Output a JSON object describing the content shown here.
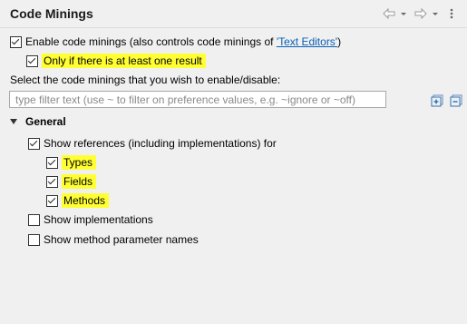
{
  "header": {
    "title": "Code Minings",
    "back_icon": "arrow-left-icon",
    "forward_icon": "arrow-right-icon",
    "menu_icon": "chevron-down-icon"
  },
  "options": {
    "enable": {
      "prefix": "Enable code minings (also controls code minings of ",
      "link": "'Text Editors'",
      "suffix": ")",
      "checked": true
    },
    "only_if_result": {
      "label": "Only if there is at least one result",
      "checked": true
    }
  },
  "filter": {
    "instruction": "Select the code minings that you wish to enable/disable:",
    "placeholder": "type filter text (use ~ to filter on preference values, e.g. ~ignore or ~off)",
    "value": ""
  },
  "toolbar": {
    "expand_all_icon": "expand-all-icon",
    "collapse_all_icon": "collapse-all-icon"
  },
  "tree": {
    "group_label": "General",
    "items": [
      {
        "label": "Show references (including implementations) for",
        "checked": true
      },
      {
        "label": "Types",
        "checked": true
      },
      {
        "label": "Fields",
        "checked": true
      },
      {
        "label": "Methods",
        "checked": true
      },
      {
        "label": "Show implementations",
        "checked": false
      },
      {
        "label": "Show method parameter names",
        "checked": false
      }
    ]
  },
  "colors": {
    "highlight": "#ffff33",
    "link": "#0b5fb6",
    "background": "#f0f0f0"
  }
}
